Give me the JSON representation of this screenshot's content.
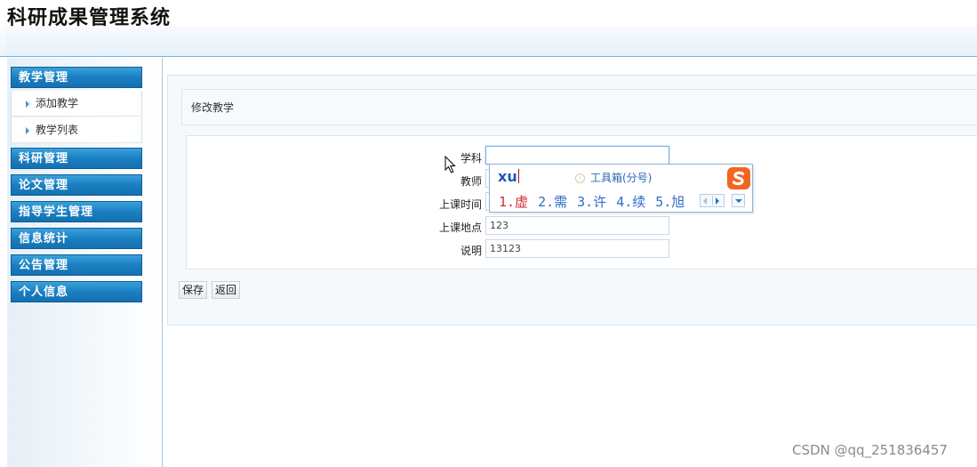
{
  "app": {
    "title": "科研成果管理系统"
  },
  "sidebar": {
    "menus": [
      {
        "label": "教学管理",
        "items": [
          "添加教学",
          "教学列表"
        ]
      },
      {
        "label": "科研管理"
      },
      {
        "label": "论文管理"
      },
      {
        "label": "指导学生管理"
      },
      {
        "label": "信息统计"
      },
      {
        "label": "公告管理"
      },
      {
        "label": "个人信息"
      }
    ]
  },
  "main": {
    "section_title": "修改教学",
    "form": {
      "fields": [
        {
          "label": "学科",
          "value": ""
        },
        {
          "label": "教师",
          "value": ""
        },
        {
          "label": "上课时间",
          "value": ""
        },
        {
          "label": "上课地点",
          "value": "123"
        },
        {
          "label": "说明",
          "value": "13123"
        }
      ],
      "save_label": "保存",
      "back_label": "返回"
    }
  },
  "ime": {
    "composition": "xu",
    "toolbox_label": "工具箱(分号)",
    "candidates": [
      "1.虚",
      "2.需",
      "3.许",
      "4.续",
      "5.旭"
    ],
    "logo_color": "#f26522"
  },
  "watermark": "CSDN @qq_251836457"
}
